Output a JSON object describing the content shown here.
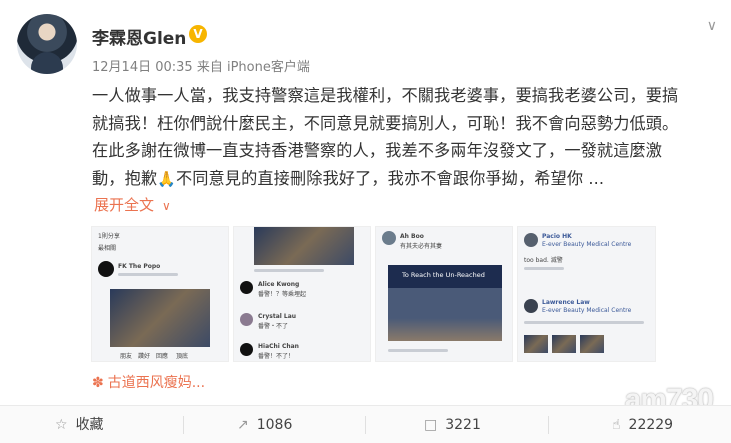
{
  "post": {
    "username": "李霖恩Glen",
    "verified_badge": "V",
    "time": "12月14日 00:35",
    "source_prefix": "来自",
    "source": "iPhone客户端",
    "text_part1": "一人做事一人當，我支持警察這是我權利，不關我老婆事，要搞我老婆公司，要搞就搞我！枉你們說什麼民主，不同意見就要搞別人，可恥！我不會向惡勢力低頭。在此多謝在微博一直支持香港警察的人，我差不多兩年沒發文了，一發就這麼激動，抱歉",
    "emoji": "🙏",
    "text_part2": "不同意見的直接刪除我好了，我亦不會跟你爭拗，希望你 ...",
    "expand_label": "展开全文",
    "location": "古道西风瘦妈...",
    "colors": {
      "accent": "#eb7350",
      "verified": "#f7b500"
    }
  },
  "thumbs": {
    "t1_header": "1則分享",
    "t1_sort": "最相關",
    "t1_name": "FK The Popo",
    "t1_actions": [
      "朋友",
      "讚好",
      "回應",
      "頂底"
    ],
    "t2_c1_name": "Alice Kwong",
    "t2_c1_text": "番警！？等乘埋起",
    "t2_c2_name": "Crystal Lau",
    "t2_c2_text": "番警・不了",
    "t2_c3_name": "HiaChi Chan",
    "t2_c3_text": "番警！不了！",
    "t3_name": "Ah Boo",
    "t3_text": "有其夫必有其妻",
    "t3_banner": "To Reach the Un-Reached",
    "t4_p1_name": "Pacio HK",
    "t4_p1_page": "E-ever Beauty Medical Centre",
    "t4_p1_text": "too bad. 滅警",
    "t4_p2_name": "Lawrence Law",
    "t4_p2_page": "E-ever Beauty Medical Centre"
  },
  "footer": {
    "favorite_label": "收藏",
    "repost_count": "1086",
    "comment_count": "3221",
    "like_count": "22229"
  },
  "watermark": "am730"
}
